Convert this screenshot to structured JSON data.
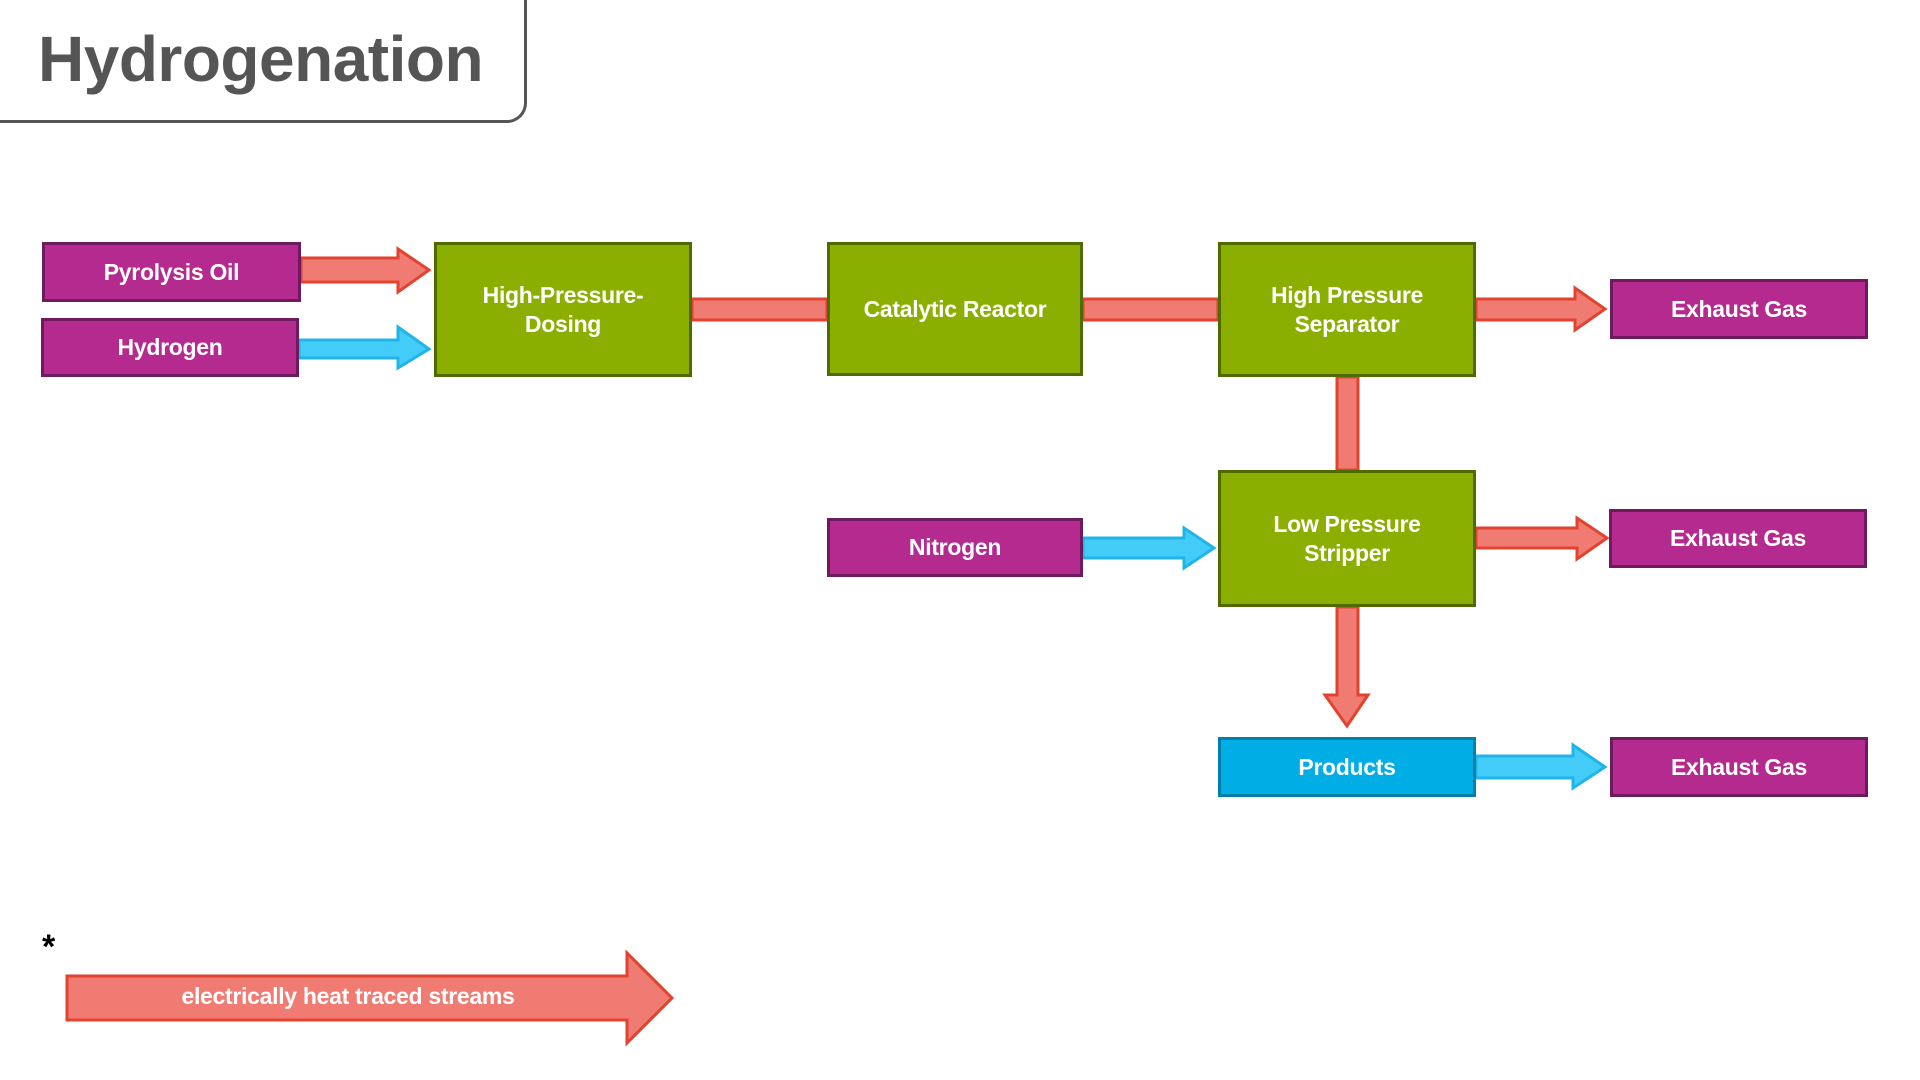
{
  "title": "Hydrogenation",
  "colors": {
    "source_fill": "#B42A8E",
    "process_fill": "#8BAF00",
    "product_fill": "#00AEE5",
    "heat_traced_stream": "#F07B72",
    "heat_traced_stroke": "#E2432F",
    "normal_stream": "#44CCF8",
    "normal_stream_stroke": "#1FB4EA"
  },
  "nodes": {
    "pyrolysis_oil": {
      "label": "Pyrolysis Oil",
      "type": "source"
    },
    "hydrogen": {
      "label": "Hydrogen",
      "type": "source"
    },
    "high_pressure_dosing": {
      "label": "High-Pressure-\nDosing",
      "type": "process"
    },
    "catalytic_reactor": {
      "label": "Catalytic Reactor",
      "type": "process"
    },
    "high_pressure_separator": {
      "label": "High Pressure\nSeparator",
      "type": "process"
    },
    "nitrogen": {
      "label": "Nitrogen",
      "type": "source"
    },
    "low_pressure_stripper": {
      "label": "Low Pressure\nStripper",
      "type": "process"
    },
    "products": {
      "label": "Products",
      "type": "product"
    },
    "exhaust_gas_1": {
      "label": "Exhaust Gas",
      "type": "source"
    },
    "exhaust_gas_2": {
      "label": "Exhaust Gas",
      "type": "source"
    },
    "exhaust_gas_3": {
      "label": "Exhaust Gas",
      "type": "source"
    }
  },
  "edges": [
    {
      "from": "pyrolysis_oil",
      "to": "high_pressure_dosing",
      "stream": "heat_traced",
      "arrowhead": true
    },
    {
      "from": "hydrogen",
      "to": "high_pressure_dosing",
      "stream": "normal",
      "arrowhead": true
    },
    {
      "from": "high_pressure_dosing",
      "to": "catalytic_reactor",
      "stream": "heat_traced",
      "arrowhead": false
    },
    {
      "from": "catalytic_reactor",
      "to": "high_pressure_separator",
      "stream": "heat_traced",
      "arrowhead": false
    },
    {
      "from": "high_pressure_separator",
      "to": "exhaust_gas_1",
      "stream": "heat_traced",
      "arrowhead": true
    },
    {
      "from": "high_pressure_separator",
      "to": "low_pressure_stripper",
      "stream": "heat_traced",
      "arrowhead": false
    },
    {
      "from": "nitrogen",
      "to": "low_pressure_stripper",
      "stream": "normal",
      "arrowhead": true
    },
    {
      "from": "low_pressure_stripper",
      "to": "exhaust_gas_2",
      "stream": "heat_traced",
      "arrowhead": true
    },
    {
      "from": "low_pressure_stripper",
      "to": "products",
      "stream": "heat_traced",
      "arrowhead": true
    },
    {
      "from": "products",
      "to": "exhaust_gas_3",
      "stream": "normal",
      "arrowhead": true
    }
  ],
  "legend": {
    "marker": "*",
    "label": "electrically heat traced streams",
    "stream": "heat_traced"
  }
}
